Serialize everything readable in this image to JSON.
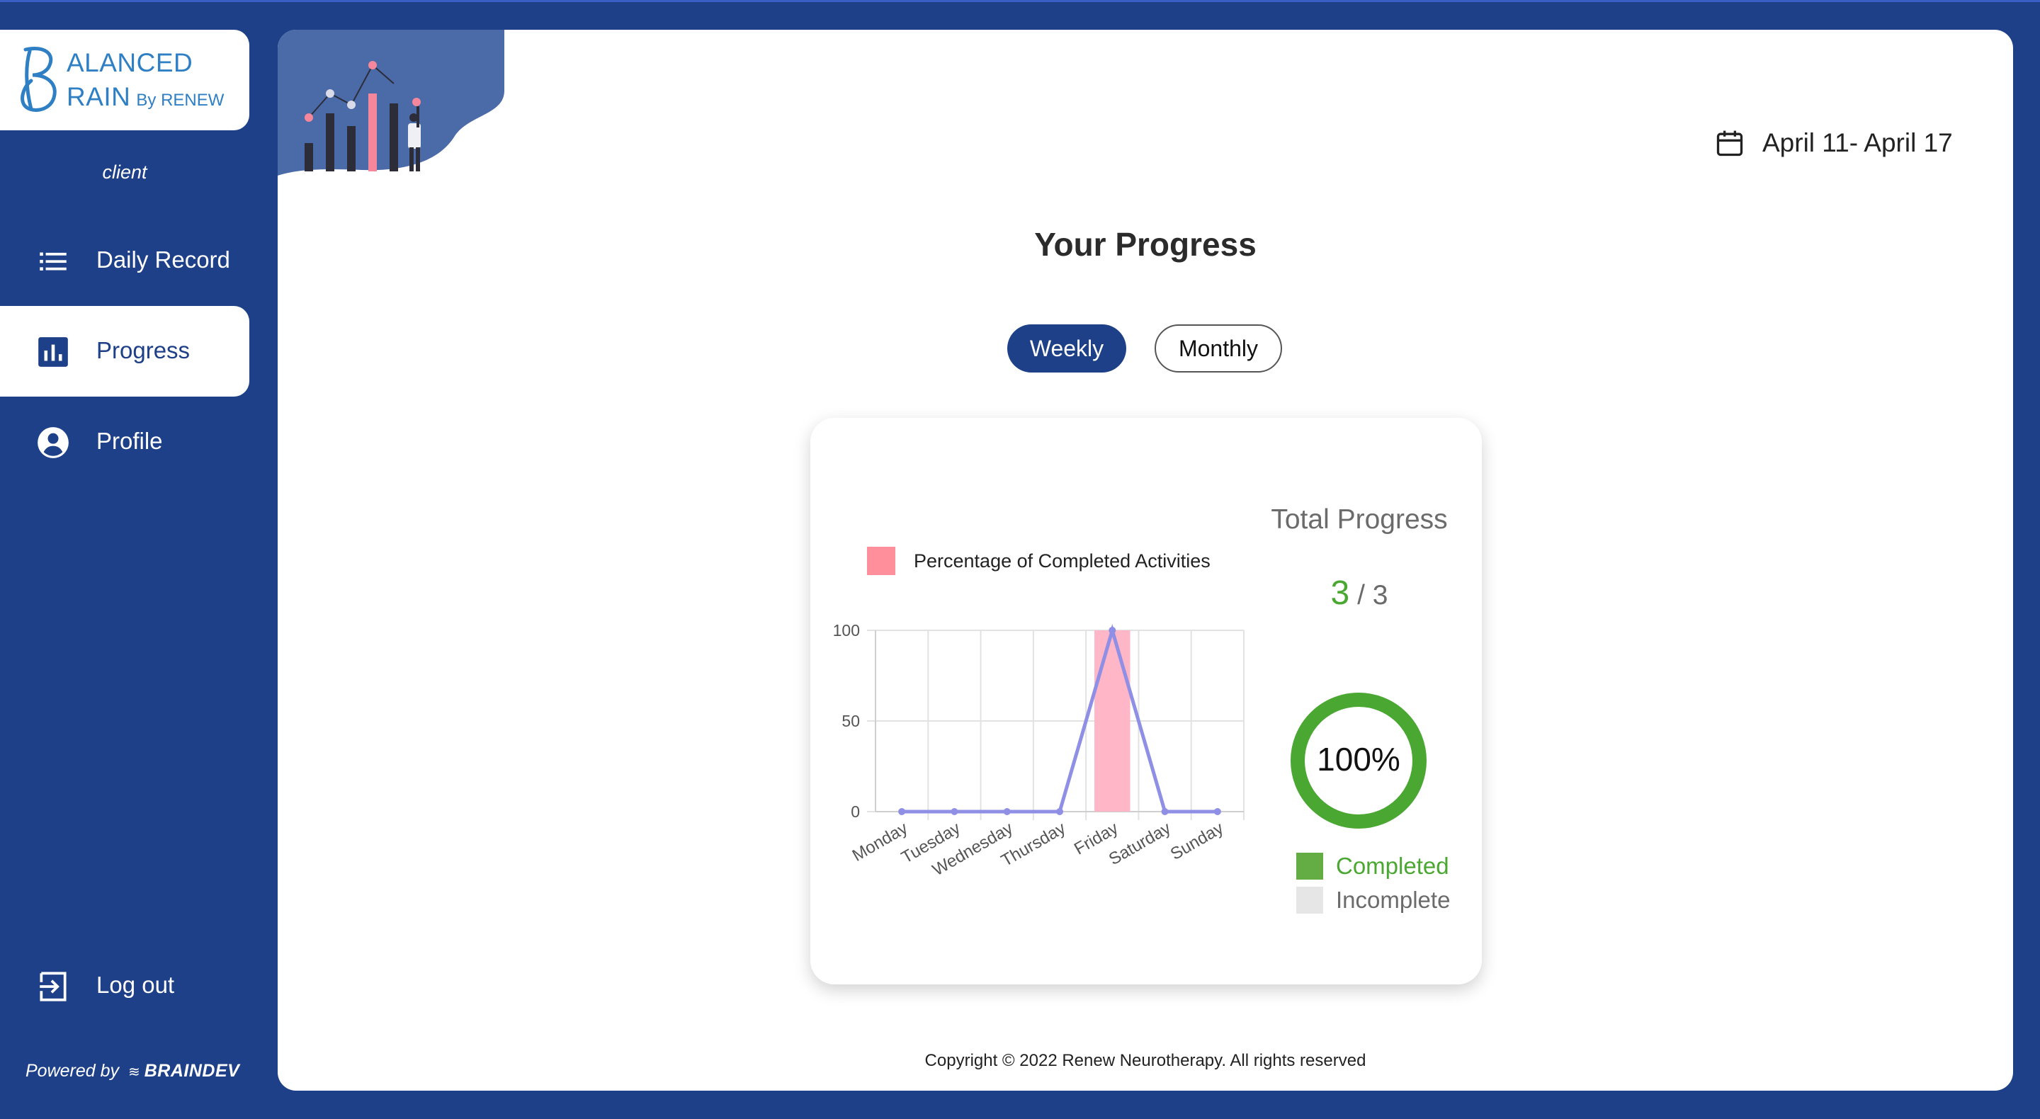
{
  "logo": {
    "line1": "ALANCED",
    "line2": "RAIN",
    "by": "By RENEW"
  },
  "sidebar": {
    "role": "client",
    "items": [
      {
        "label": "Daily Record",
        "icon": "list-icon",
        "active": false
      },
      {
        "label": "Progress",
        "icon": "bar-chart-icon",
        "active": true
      },
      {
        "label": "Profile",
        "icon": "account-circle-icon",
        "active": false
      }
    ],
    "logout": {
      "label": "Log out",
      "icon": "logout-icon"
    },
    "powered": {
      "prefix": "Powered by",
      "brand": "BRAINDEV"
    }
  },
  "header": {
    "date_range": "April 11- April 17",
    "icon": "calendar-icon"
  },
  "page": {
    "title": "Your Progress",
    "tabs": [
      {
        "label": "Weekly",
        "selected": true
      },
      {
        "label": "Monthly",
        "selected": false
      }
    ]
  },
  "chart_data": {
    "type": "bar",
    "categories": [
      "Monday",
      "Tuesday",
      "Wednesday",
      "Thursday",
      "Friday",
      "Saturday",
      "Sunday"
    ],
    "series": [
      {
        "name": "Percentage of Completed Activities",
        "type": "bar",
        "values": [
          0,
          0,
          0,
          0,
          100,
          0,
          0
        ],
        "color": "#ffb6c6"
      },
      {
        "type": "line",
        "values": [
          0,
          0,
          0,
          0,
          100,
          0,
          0
        ],
        "color": "#8f8fe6"
      }
    ],
    "ylim": [
      0,
      100
    ],
    "yticks": [
      0,
      50,
      100
    ],
    "grid": true,
    "legend": "top"
  },
  "total_progress": {
    "title": "Total Progress",
    "completed": "3",
    "total": "/ 3",
    "percent_label": "100%",
    "percent": 100,
    "legend": {
      "completed": "Completed",
      "incomplete": "Incomplete"
    },
    "colors": {
      "completed": "#4aa832",
      "incomplete": "#e6e6e6"
    }
  },
  "footer": {
    "copyright": "Copyright © 2022 Renew Neurotherapy. All rights reserved"
  }
}
